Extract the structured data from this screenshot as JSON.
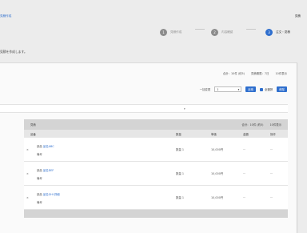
{
  "header": {
    "breadcrumb": "見積作成",
    "right_text": "見積"
  },
  "steps": [
    {
      "num": "1",
      "label": "見積作成",
      "active": false
    },
    {
      "num": "2",
      "label": "内容確認",
      "active": false
    },
    {
      "num": "3",
      "label": "注文・見積",
      "active": true
    }
  ],
  "subtitle": "見積を作成します。",
  "meta": [
    "合計：10件 (約5)",
    "見積期限：7日",
    "10件表示"
  ],
  "controls": {
    "text": "一括変更",
    "select_value": "1",
    "button1": "反映",
    "checkbox_label": "全選択",
    "button2": "削除"
  },
  "table": {
    "header_left": "見積",
    "header_right": "合計：10件 (約5)",
    "header_count": "10件表示",
    "columns": [
      "品番",
      "数量",
      "単価",
      "金額",
      "操作"
    ],
    "rows": [
      {
        "remove": "×",
        "label": "部品",
        "link": "品名ABC",
        "sub": "備考",
        "qty": "数量 1",
        "unit": "10,000円",
        "price": "...",
        "more": "..."
      },
      {
        "remove": "×",
        "label": "部品",
        "link": "品名DEF",
        "sub": "備考",
        "qty": "数量 1",
        "unit": "10,000円",
        "price": "...",
        "more": "..."
      },
      {
        "remove": "×",
        "label": "部品",
        "link": "品名GHI 詳細",
        "sub": "備考",
        "qty": "数量 1",
        "unit": "10,000円",
        "price": "...",
        "more": "..."
      }
    ]
  },
  "colors": {
    "accent": "#2f6fce",
    "header_gray": "#d4d4d4",
    "page_bg": "#ececec"
  }
}
